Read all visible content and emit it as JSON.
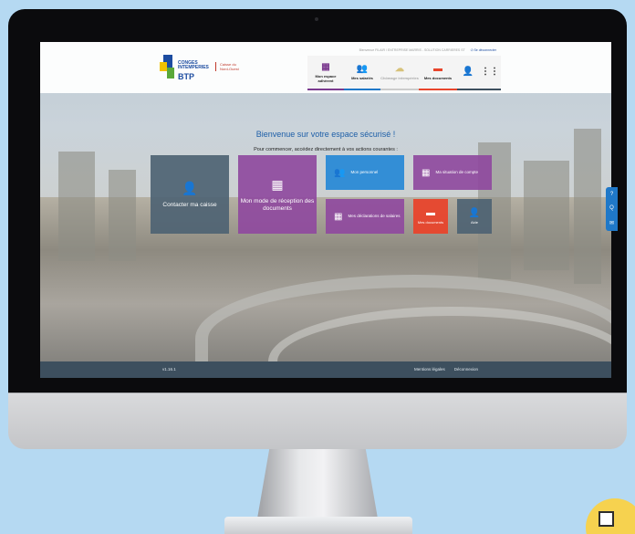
{
  "header": {
    "logo_line1": "CONGES",
    "logo_line2": "INTEMPERIES",
    "logo_brand": "BTP",
    "caisse_label": "Caisse du Nord-Ouest",
    "greeting": "Bienvenue FILAIR / ENTREPRISE MARRIS - SOLUTION CARRIERES ST",
    "logout_label": "Se déconnecter"
  },
  "nav": {
    "items": [
      {
        "label": "Mon espace adhérent",
        "icon": "building-icon",
        "color": "#7b3a8f"
      },
      {
        "label": "Mes salariés",
        "icon": "employees-icon",
        "color": "#1f78c8"
      },
      {
        "label": "Chômage intempéries",
        "icon": "weather-icon",
        "color": "#cccccc"
      },
      {
        "label": "Mes documents",
        "icon": "folder-icon",
        "color": "#e8452c"
      },
      {
        "label": "",
        "icon": "help-user-icon",
        "color": "#3d4f5e"
      },
      {
        "label": "",
        "icon": "grid-menu-icon",
        "color": "#3d4f5e"
      }
    ]
  },
  "main": {
    "welcome": "Bienvenue sur votre espace sécurisé !",
    "subtitle": "Pour commencer, accédez directement à vos actions courantes :"
  },
  "tiles": {
    "contact": "Contacter ma caisse",
    "reception": "Mon mode de réception des documents",
    "personnel": "Mon personnel",
    "situation": "Ma situation de compte",
    "declarations": "Mes déclarations de salaires",
    "documents": "Mes documents",
    "aide": "Aide"
  },
  "colors": {
    "slate": "#4e6373",
    "purple": "#8f4a9e",
    "blue": "#2a8ad6",
    "orange": "#e8452c"
  },
  "dock": {
    "icons": [
      "help-circle-icon",
      "faq-icon",
      "mail-icon"
    ]
  },
  "footer": {
    "version": "v1.16.1",
    "legal": "Mentions légales",
    "logout": "Déconnexion"
  }
}
